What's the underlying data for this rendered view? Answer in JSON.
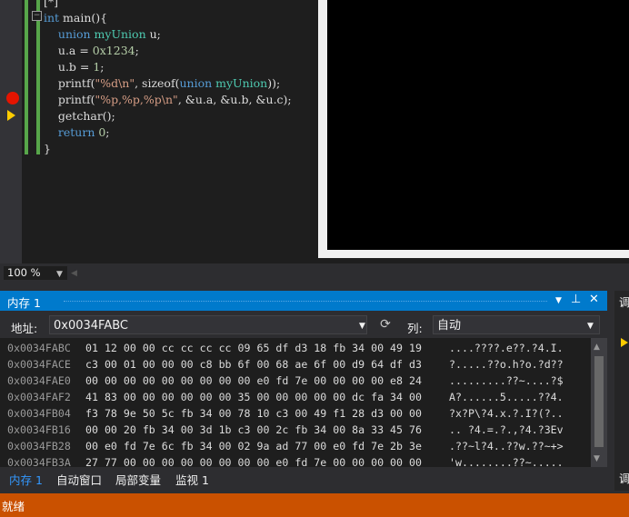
{
  "editor": {
    "code_lines": [
      {
        "tokens": [
          {
            "t": "[*]",
            "c": "fn"
          }
        ]
      },
      {
        "tokens": [
          {
            "t": "int ",
            "c": "kw"
          },
          {
            "t": "main(){",
            "c": "fn"
          }
        ]
      },
      {
        "tokens": [
          {
            "t": "    union ",
            "c": "kw"
          },
          {
            "t": "myUnion ",
            "c": "ty"
          },
          {
            "t": "u;",
            "c": "fn"
          }
        ]
      },
      {
        "tokens": [
          {
            "t": "    u.a = ",
            "c": "fn"
          },
          {
            "t": "0x1234",
            "c": "nm"
          },
          {
            "t": ";",
            "c": "fn"
          }
        ]
      },
      {
        "tokens": [
          {
            "t": "    u.b = ",
            "c": "fn"
          },
          {
            "t": "1",
            "c": "nm"
          },
          {
            "t": ";",
            "c": "fn"
          }
        ]
      },
      {
        "tokens": [
          {
            "t": "    printf(",
            "c": "fn"
          },
          {
            "t": "\"%d\\n\"",
            "c": "st"
          },
          {
            "t": ", sizeof(",
            "c": "fn"
          },
          {
            "t": "union ",
            "c": "kw"
          },
          {
            "t": "myUnion",
            "c": "ty"
          },
          {
            "t": "));",
            "c": "fn"
          }
        ]
      },
      {
        "tokens": [
          {
            "t": "    printf(",
            "c": "fn"
          },
          {
            "t": "\"%p,%p,%p\\n\"",
            "c": "st"
          },
          {
            "t": ", &u.a, &u.b, &u.c);",
            "c": "fn"
          }
        ]
      },
      {
        "tokens": [
          {
            "t": "    getchar();",
            "c": "fn"
          }
        ]
      },
      {
        "tokens": [
          {
            "t": "    return ",
            "c": "kw"
          },
          {
            "t": "0",
            "c": "nm"
          },
          {
            "t": ";",
            "c": "fn"
          }
        ]
      },
      {
        "tokens": [
          {
            "t": "}",
            "c": "fn"
          }
        ]
      }
    ],
    "zoom": "100 %"
  },
  "memory": {
    "title": "内存 1",
    "address_label": "地址:",
    "address_value": "0x0034FABC",
    "columns_label": "列:",
    "columns_value": "自动",
    "rows": [
      {
        "addr": "0x0034FABC",
        "hex": "01 12 00 00 cc cc cc cc 09 65 df d3 18 fb 34 00 49 19",
        "chars": "....????.e??.?4.I."
      },
      {
        "addr": "0x0034FACE",
        "hex": "c3 00 01 00 00 00 c8 bb 6f 00 68 ae 6f 00 d9 64 df d3",
        "chars": "?.....??o.h?o.?d??"
      },
      {
        "addr": "0x0034FAE0",
        "hex": "00 00 00 00 00 00 00 00 00 e0 fd 7e 00 00 00 00 e8 24",
        "chars": ".........??~....?$"
      },
      {
        "addr": "0x0034FAF2",
        "hex": "41 83 00 00 00 00 00 00 35 00 00 00 00 00 dc fa 34 00",
        "chars": "A?......5.....??4."
      },
      {
        "addr": "0x0034FB04",
        "hex": "f3 78 9e 50 5c fb 34 00 78 10 c3 00 49 f1 28 d3 00 00",
        "chars": "?x?P\\?4.x.?.I?(?.."
      },
      {
        "addr": "0x0034FB16",
        "hex": "00 00 20 fb 34 00 3d 1b c3 00 2c fb 34 00 8a 33 45 76",
        "chars": ".. ?4.=.?.,?4.?3Ev"
      },
      {
        "addr": "0x0034FB28",
        "hex": "00 e0 fd 7e 6c fb 34 00 02 9a ad 77 00 e0 fd 7e 2b 3e",
        "chars": ".??~l?4..??w.??~+>"
      },
      {
        "addr": "0x0034FB3A",
        "hex": "27 77 00 00 00 00 00 00 00 00 e0 fd 7e 00 00 00 00 00",
        "chars": "'w........??~....."
      }
    ]
  },
  "bottom_tabs": [
    "内存 1",
    "自动窗口",
    "局部变量",
    "监视 1"
  ],
  "right_panel": {
    "top_label": "调",
    "bottom_label": "调"
  },
  "status": "就绪"
}
